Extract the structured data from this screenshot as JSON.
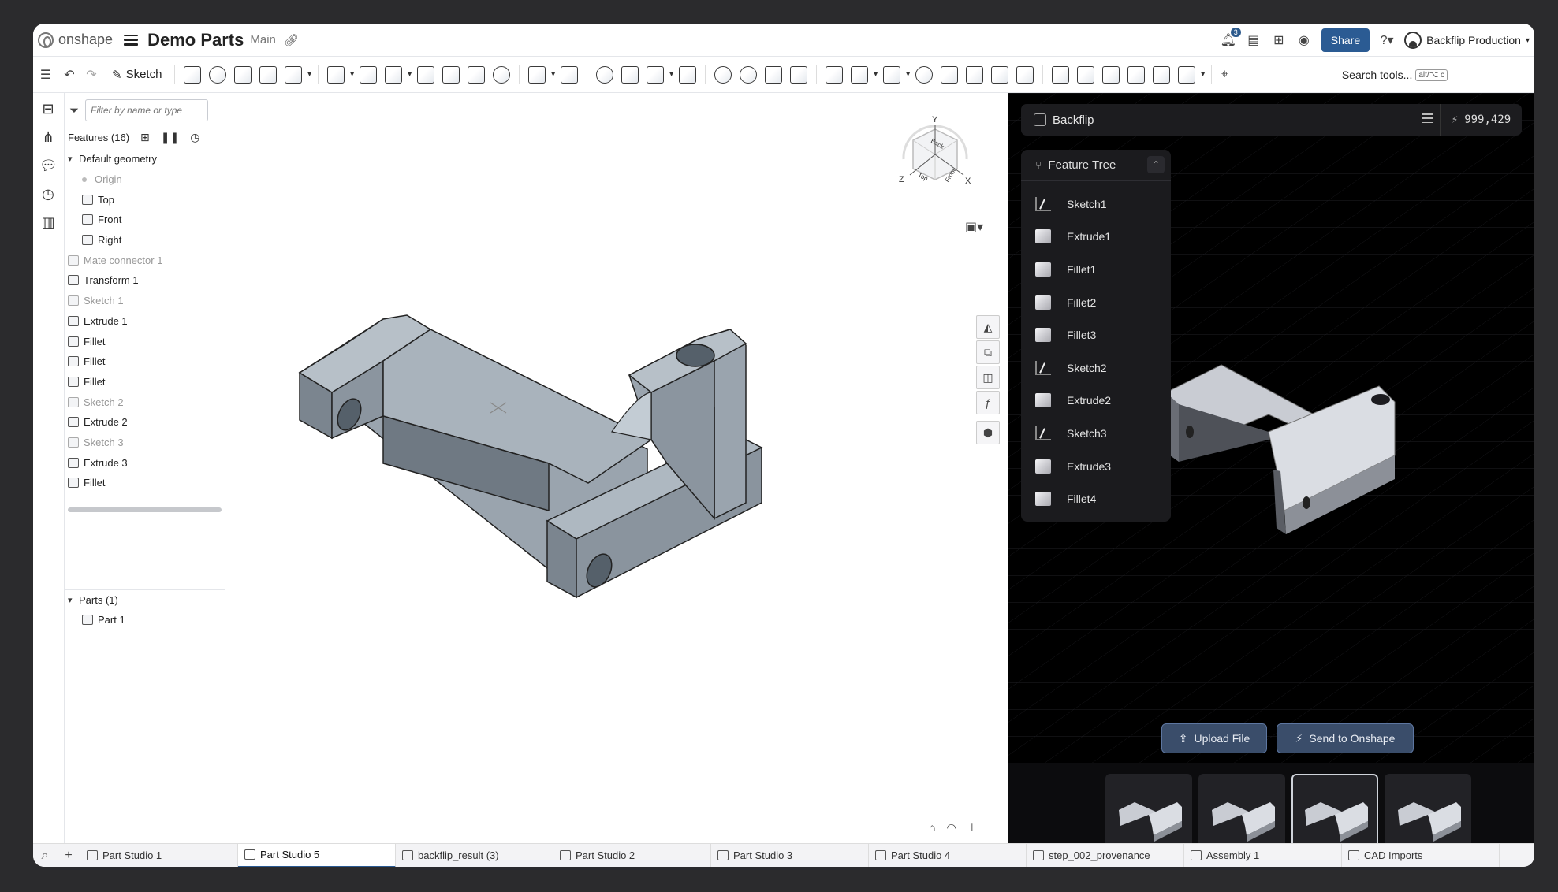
{
  "topbar": {
    "logo_text": "onshape",
    "doc_title": "Demo Parts",
    "branch": "Main",
    "notification_count": "3",
    "share_label": "Share",
    "user_name": "Backflip Production"
  },
  "toolbar": {
    "sketch_label": "Sketch",
    "search_label": "Search tools...",
    "search_shortcut": "alt/⌥ c"
  },
  "features": {
    "filter_placeholder": "Filter by name or type",
    "header": "Features (16)",
    "default_geometry": "Default geometry",
    "items": [
      {
        "label": "Origin",
        "muted": true
      },
      {
        "label": "Top"
      },
      {
        "label": "Front"
      },
      {
        "label": "Right"
      },
      {
        "label": "Mate connector 1",
        "muted": true
      },
      {
        "label": "Transform 1"
      },
      {
        "label": "Sketch 1",
        "muted": true
      },
      {
        "label": "Extrude 1"
      },
      {
        "label": "Fillet"
      },
      {
        "label": "Fillet"
      },
      {
        "label": "Fillet"
      },
      {
        "label": "Sketch 2",
        "muted": true
      },
      {
        "label": "Extrude 2"
      },
      {
        "label": "Sketch 3",
        "muted": true
      },
      {
        "label": "Extrude 3"
      },
      {
        "label": "Fillet"
      }
    ],
    "parts_header": "Parts (1)",
    "part_item": "Part 1"
  },
  "viewcube": {
    "top": "Top",
    "back": "Back",
    "front": "Front",
    "axis_x": "X",
    "axis_y": "Y",
    "axis_z": "Z"
  },
  "backflip": {
    "title": "Backflip",
    "credits": "999,429",
    "tree_title": "Feature Tree",
    "tree_items": [
      {
        "label": "Sketch1",
        "kind": "sketch"
      },
      {
        "label": "Extrude1",
        "kind": "solid"
      },
      {
        "label": "Fillet1",
        "kind": "solid"
      },
      {
        "label": "Fillet2",
        "kind": "solid"
      },
      {
        "label": "Fillet3",
        "kind": "solid"
      },
      {
        "label": "Sketch2",
        "kind": "sketch"
      },
      {
        "label": "Extrude2",
        "kind": "solid"
      },
      {
        "label": "Sketch3",
        "kind": "sketch"
      },
      {
        "label": "Extrude3",
        "kind": "solid"
      },
      {
        "label": "Fillet4",
        "kind": "solid"
      }
    ],
    "upload_label": "Upload File",
    "send_label": "Send to Onshape"
  },
  "tabs": [
    {
      "label": "Part Studio 1"
    },
    {
      "label": "Part Studio 5",
      "active": true
    },
    {
      "label": "backflip_result (3)"
    },
    {
      "label": "Part Studio 2"
    },
    {
      "label": "Part Studio 3"
    },
    {
      "label": "Part Studio 4"
    },
    {
      "label": "step_002_provenance"
    },
    {
      "label": "Assembly 1"
    },
    {
      "label": "CAD Imports"
    }
  ],
  "colors": {
    "accent": "#2b5b93",
    "part_fill": "#aab4be",
    "dark_panel": "#000000"
  }
}
